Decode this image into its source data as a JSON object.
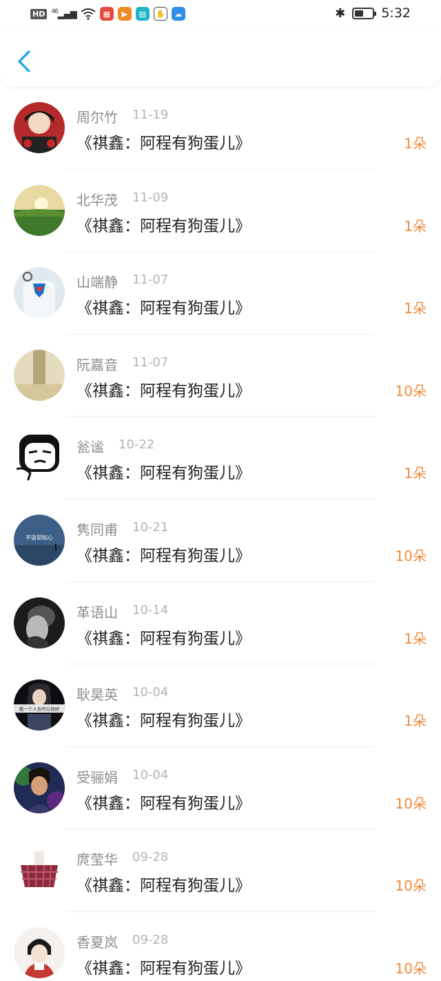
{
  "status_bar": {
    "network": "HD",
    "signal": "46",
    "time": "5:32",
    "battery_level": 0.5
  },
  "navbar": {
    "back_icon": "chevron-left-icon"
  },
  "colors": {
    "accent": "#1aa3e8",
    "amount": "#ef8a3a"
  },
  "items": [
    {
      "name": "周尔竹",
      "date": "11-19",
      "title": "《祺鑫：阿程有狗蛋儿》",
      "amount": "1朵"
    },
    {
      "name": "北华茂",
      "date": "11-09",
      "title": "《祺鑫：阿程有狗蛋儿》",
      "amount": "1朵"
    },
    {
      "name": "山端静",
      "date": "11-07",
      "title": "《祺鑫：阿程有狗蛋儿》",
      "amount": "1朵"
    },
    {
      "name": "阮嘉音",
      "date": "11-07",
      "title": "《祺鑫：阿程有狗蛋儿》",
      "amount": "10朵"
    },
    {
      "name": "瓮谧",
      "date": "10-22",
      "title": "《祺鑫：阿程有狗蛋儿》",
      "amount": "1朵"
    },
    {
      "name": "隽同甫",
      "date": "10-21",
      "title": "《祺鑫：阿程有狗蛋儿》",
      "amount": "10朵",
      "avatar_text": "不语却知心"
    },
    {
      "name": "革语山",
      "date": "10-14",
      "title": "《祺鑫：阿程有狗蛋儿》",
      "amount": "1朵"
    },
    {
      "name": "耿昊英",
      "date": "10-04",
      "title": "《祺鑫：阿程有狗蛋儿》",
      "amount": "1朵",
      "avatar_text": "我一个人也可以很好"
    },
    {
      "name": "受骊娟",
      "date": "10-04",
      "title": "《祺鑫：阿程有狗蛋儿》",
      "amount": "10朵"
    },
    {
      "name": "庹莹华",
      "date": "09-28",
      "title": "《祺鑫：阿程有狗蛋儿》",
      "amount": "10朵"
    },
    {
      "name": "香夏岚",
      "date": "09-28",
      "title": "《祺鑫：阿程有狗蛋儿》",
      "amount": "10朵"
    }
  ]
}
